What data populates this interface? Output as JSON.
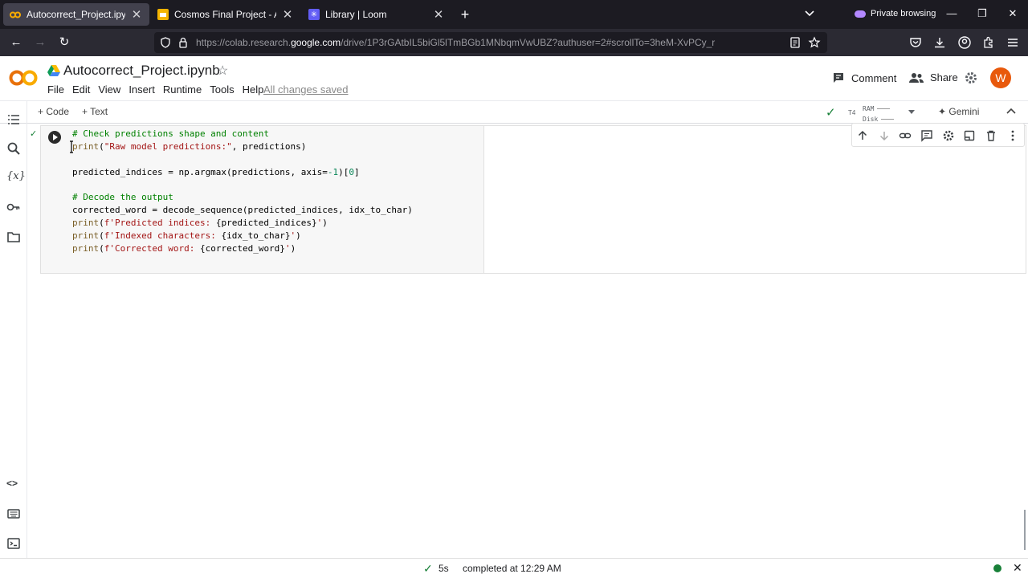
{
  "browser": {
    "tabs": [
      {
        "title": "Autocorrect_Project.ipynb - Colab",
        "active": true,
        "icon": "colab-icon"
      },
      {
        "title": "Cosmos Final Project - Aadhi K",
        "active": false,
        "icon": "slides-icon"
      },
      {
        "title": "Library | Loom",
        "active": false,
        "icon": "loom-icon"
      }
    ],
    "private_label": "Private browsing",
    "url_prefix": "https://colab.research.",
    "url_domain": "google.com",
    "url_rest": "/drive/1P3rGAtbIL5biGl5lTmBGb1MNbqmVwUBZ?authuser=2#scrollTo=3heM-XvPCy_r"
  },
  "colab": {
    "notebook_title": "Autocorrect_Project.ipynb",
    "menu": [
      "File",
      "Edit",
      "View",
      "Insert",
      "Runtime",
      "Tools",
      "Help"
    ],
    "save_status": "All changes saved",
    "comment_label": "Comment",
    "share_label": "Share",
    "avatar_letter": "W",
    "toolbar": {
      "code_label": "+ Code",
      "text_label": "+ Text",
      "runtime": "T4",
      "ram_label": "RAM",
      "disk_label": "Disk",
      "gemini_label": "Gemini"
    }
  },
  "cell": {
    "lines": [
      "# Check predictions shape and content",
      "print(\"Raw model predictions:\", predictions)",
      "",
      "predicted_indices = np.argmax(predictions, axis=-1)[0]",
      "",
      "# Decode the output",
      "corrected_word = decode_sequence(predicted_indices, idx_to_char)",
      "print(f'Predicted indices: {predicted_indices}')",
      "print(f'Indexed characters: {idx_to_char}')",
      "print(f'Corrected word: {corrected_word}')"
    ]
  },
  "status": {
    "duration": "5s",
    "completed_text": "completed at 12:29 AM"
  },
  "colors": {
    "accent_orange": "#f9ab00",
    "success_green": "#188038",
    "avatar_bg": "#e8590c"
  }
}
